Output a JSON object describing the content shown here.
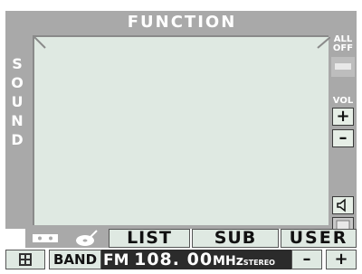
{
  "header": {
    "title": "FUNCTION"
  },
  "side_label": {
    "letters": [
      "S",
      "O",
      "U",
      "N",
      "D"
    ]
  },
  "right_panel": {
    "all_off_line1": "ALL",
    "all_off_line2": "OFF",
    "vol_label": "VOL",
    "vol_up": "+",
    "vol_down": "–"
  },
  "tabs": {
    "list": "LIST",
    "sub": "SUB",
    "user": "USER"
  },
  "status": {
    "band_button": "BAND",
    "band": "FM",
    "frequency": "108. 00",
    "unit": "MHz",
    "stereo": "STEREO",
    "minus": "–",
    "plus": "+"
  },
  "icons": {
    "mute": "speaker-icon",
    "display": "display-icon",
    "map": "map-icon",
    "cassette": "cassette-icon",
    "disc": "disc-icon"
  },
  "colors": {
    "frame": "#a9a9a9",
    "panel": "#dfe9e2",
    "dark": "#2b2b2b"
  }
}
